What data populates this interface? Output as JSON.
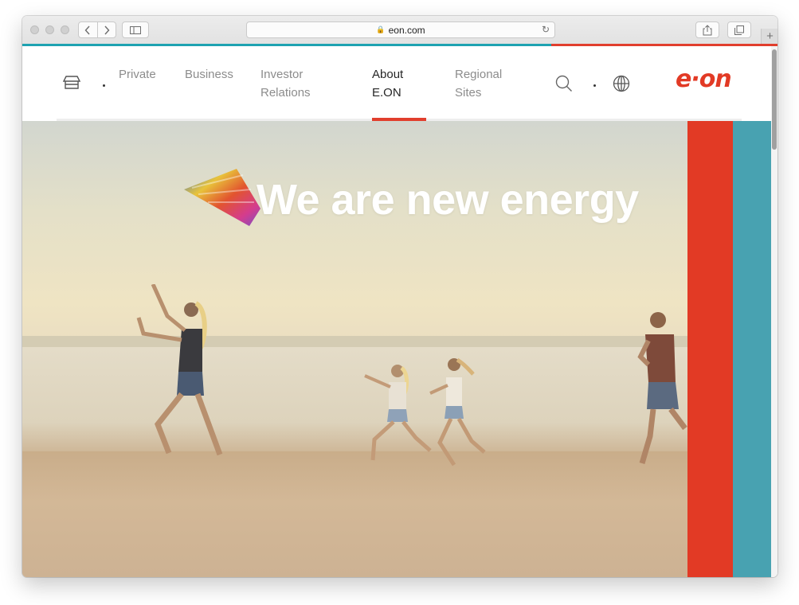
{
  "browser": {
    "url": "eon.com",
    "buttons": {
      "back": "‹",
      "forward": "›",
      "sidebar": "sidebar",
      "share": "share",
      "tabs": "tabs",
      "new_tab": "+"
    }
  },
  "header": {
    "nav": [
      {
        "label": "Private",
        "active": false
      },
      {
        "label": "Business",
        "active": false
      },
      {
        "label": "Investor\nRelations",
        "active": false
      },
      {
        "label": "About\nE.ON",
        "active": true
      },
      {
        "label": "Regional\nSites",
        "active": false
      }
    ],
    "logo_text": "e·on"
  },
  "hero": {
    "title": "We are new energy"
  },
  "colors": {
    "brand_red": "#e23a25",
    "teal": "#48a2b1",
    "stripe_teal": "#1ea2b1",
    "nav_gray": "#8c8c8c",
    "nav_active": "#262626"
  },
  "icons": [
    "home-icon",
    "search-icon",
    "globe-icon",
    "lock-icon",
    "reload-icon",
    "share-icon",
    "tabs-icon",
    "sidebar-icon"
  ]
}
